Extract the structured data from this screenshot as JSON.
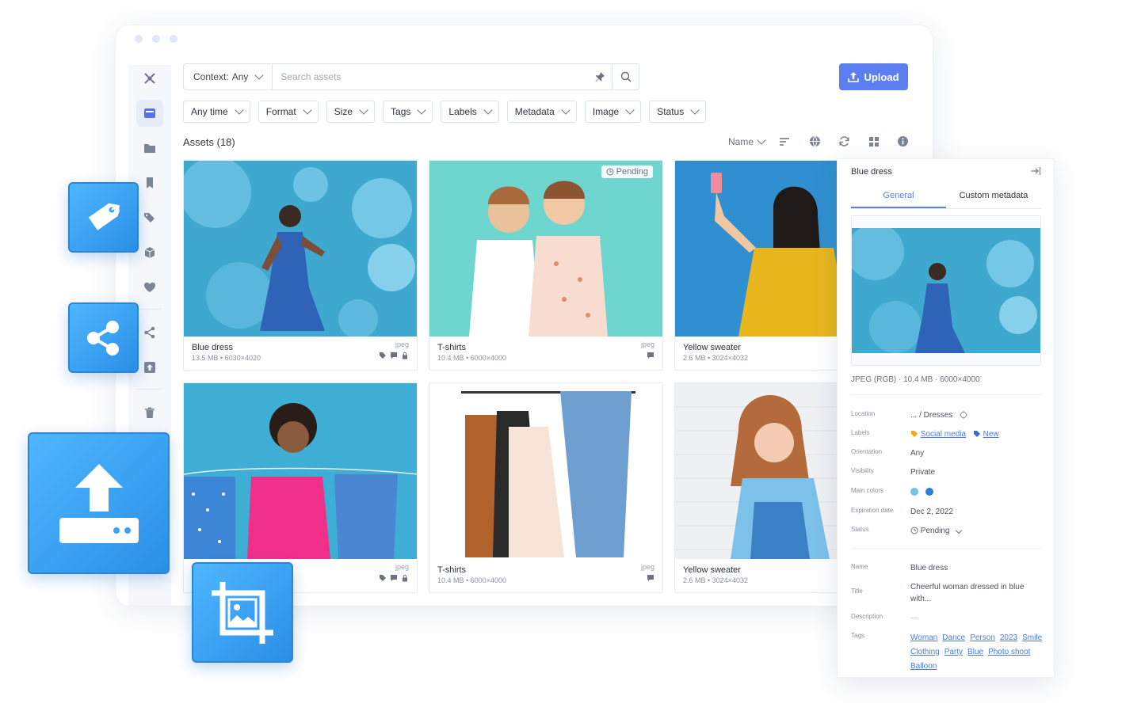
{
  "search": {
    "context_label": "Context:",
    "context_value": "Any",
    "placeholder": "Search assets"
  },
  "toolbar": {
    "upload_label": "Upload"
  },
  "filters": [
    "Any time",
    "Format",
    "Size",
    "Tags",
    "Labels",
    "Metadata",
    "Image",
    "Status"
  ],
  "assets": {
    "count_label": "Assets (18)",
    "sort_label": "Name"
  },
  "cards": [
    {
      "title": "Blue dress",
      "meta": "13.5 MB • 6030×4020",
      "type": "jpeg"
    },
    {
      "title": "T-shirts",
      "meta": "10.4  MB • 6000×4000",
      "type": "jpeg",
      "badge": "Pending"
    },
    {
      "title": "Yellow sweater",
      "meta": "2.6 MB  • 3024×4032",
      "type": ""
    },
    {
      "title": "",
      "meta": "",
      "type": "jpeg"
    },
    {
      "title": "T-shirts",
      "meta": "10.4  MB • 6000×4000",
      "type": "jpeg"
    },
    {
      "title": "Yellow sweater",
      "meta": "2.6 MB  • 3024×4032",
      "type": ""
    }
  ],
  "panel": {
    "title": "Blue dress",
    "tabs": [
      "General",
      "Custom metadata"
    ],
    "file_line": "JPEG (RGB)  ·  10.4  MB  ·  6000×4000",
    "location_key": "Location",
    "location_value": "... / Dresses",
    "labels_key": "Labels",
    "labels": [
      "Social media",
      "New"
    ],
    "orientation_key": "Orientation",
    "orientation_value": "Any",
    "visibility_key": "Visibility",
    "visibility_value": "Private",
    "colors_key": "Main colors",
    "main_colors": [
      "#6ec6e6",
      "#2f7fd6"
    ],
    "expiration_key": "Expiration date",
    "expiration_value": "Dec 2, 2022",
    "status_key": "Status",
    "status_value": "Pending",
    "name_key": "Name",
    "name_value": "Blue dress",
    "title_key": "Title",
    "title_value": "Cheerful woman dressed in blue with...",
    "description_key": "Description",
    "description_value": "—",
    "tags_key": "Tags",
    "tags": [
      "Woman",
      "Dance",
      "Person",
      "2023",
      "Smile",
      "Clothing",
      "Party",
      "Blue",
      "Photo shoot",
      "Balloon"
    ]
  },
  "colors": {
    "accent": "#5b7ef0",
    "tile": "#3aa3f5"
  }
}
